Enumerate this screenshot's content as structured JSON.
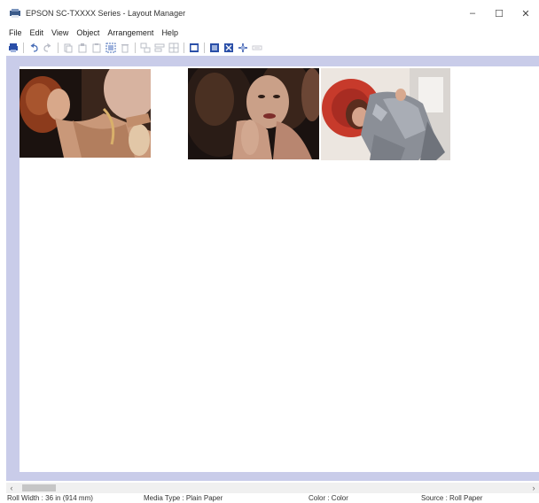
{
  "window": {
    "title": "EPSON SC-TXXXX Series - Layout Manager",
    "controls": {
      "minimize": "–",
      "maximize": "☐",
      "close": "✕"
    }
  },
  "menu": [
    {
      "label": "File"
    },
    {
      "label": "Edit"
    },
    {
      "label": "View"
    },
    {
      "label": "Object"
    },
    {
      "label": "Arrangement"
    },
    {
      "label": "Help"
    }
  ],
  "toolbar": {
    "icons": [
      "printer-icon",
      "undo-icon",
      "redo-icon",
      "cut-icon",
      "copy-icon",
      "paste-icon",
      "select-all-icon",
      "delete-icon",
      "arrange-icon",
      "align-icon",
      "grid-icon",
      "layout-view-icon",
      "page-view-icon",
      "fit-view-icon",
      "move-icon",
      "zoom-icon"
    ]
  },
  "canvas": {
    "photos": [
      {
        "name": "photo-woman-curly-hair-gold",
        "description_colors": [
          "#1b120f",
          "#a8552e",
          "#d8a88a"
        ]
      },
      {
        "name": "photo-woman-dark-curly-hair",
        "description_colors": [
          "#1a1210",
          "#6b4635",
          "#c89a82"
        ]
      },
      {
        "name": "photo-woman-red-hat",
        "description_colors": [
          "#c73a2b",
          "#ece6e0",
          "#8b8f97"
        ]
      }
    ]
  },
  "status": {
    "roll_width": "Roll Width : 36 in (914 mm)",
    "media_type": "Media Type : Plain Paper",
    "color": "Color : Color",
    "source": "Source : Roll Paper"
  },
  "colors": {
    "workspace_bg": "#c9cce9",
    "canvas_bg": "#ffffff",
    "accent_icon": "#2a4fa8"
  }
}
